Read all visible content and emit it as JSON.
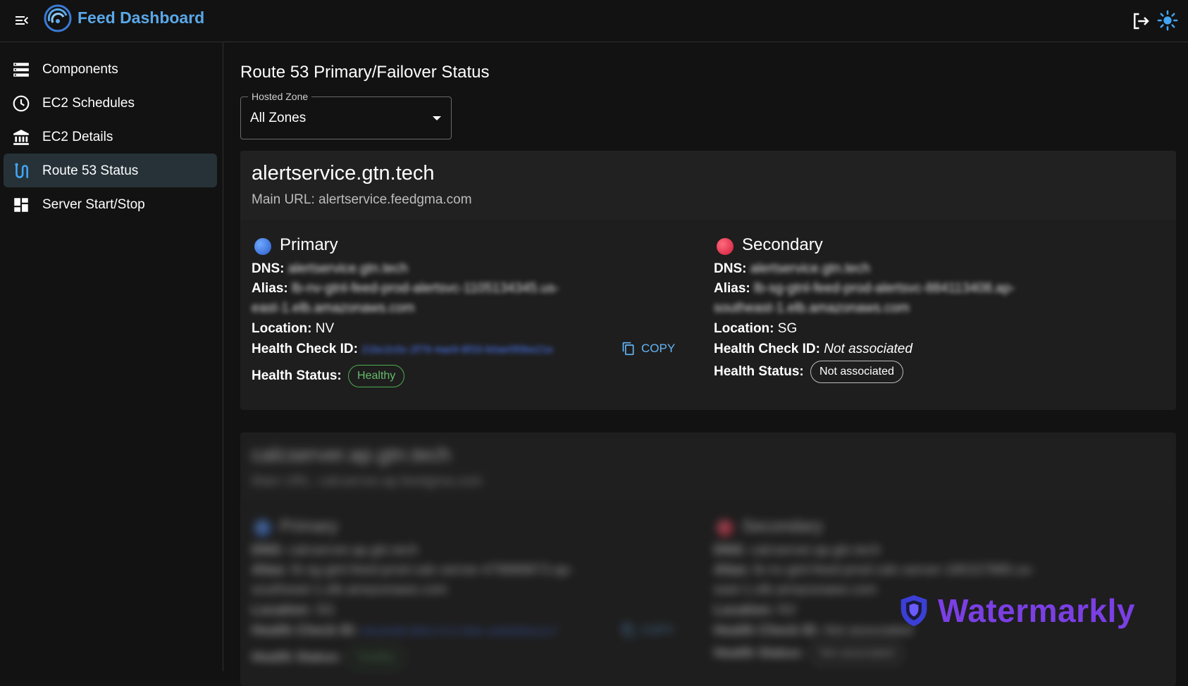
{
  "header": {
    "app_title": "Feed Dashboard",
    "menu_icon": "menu-collapse-icon",
    "logout_icon": "logout-icon",
    "theme_icon": "sun-icon",
    "brand_color": "#5aa8e8"
  },
  "sidebar": {
    "items": [
      {
        "label": "Components",
        "icon": "list-icon",
        "active": false
      },
      {
        "label": "EC2 Schedules",
        "icon": "clock-icon",
        "active": false
      },
      {
        "label": "EC2 Details",
        "icon": "bank-icon",
        "active": false
      },
      {
        "label": "Route 53 Status",
        "icon": "route-icon",
        "active": true
      },
      {
        "label": "Server Start/Stop",
        "icon": "dashboard-icon",
        "active": false
      }
    ]
  },
  "main": {
    "page_title": "Route 53 Primary/Failover Status",
    "hosted_zone": {
      "label": "Hosted Zone",
      "value": "All Zones"
    },
    "records": [
      {
        "name": "alertservice.gtn.tech",
        "main_url_label": "Main URL:",
        "main_url": "alertservice.feedgma.com",
        "primary": {
          "role": "Primary",
          "dns_label": "DNS:",
          "dns": "alertservice.gtn.tech",
          "alias_label": "Alias:",
          "alias_line1": "lb-nv-gtnl-feed-prod-alertsvc-1105134345.us-",
          "alias_line2": "east-1.elb.amazonaws.com",
          "location_label": "Location:",
          "location": "NV",
          "health_check_label": "Health Check ID:",
          "health_check_id": "21bc2c0c-2f79-4ae9-8f33-b0ae5f0be21e",
          "copy_label": "COPY",
          "health_status_label": "Health Status:",
          "health_status": "Healthy"
        },
        "secondary": {
          "role": "Secondary",
          "dns_label": "DNS:",
          "dns": "alertservice.gtn.tech",
          "alias_label": "Alias:",
          "alias_line1": "lb-sg-gtnl-feed-prod-alertsvc-884113408.ap-",
          "alias_line2": "southeast-1.elb.amazonaws.com",
          "location_label": "Location:",
          "location": "SG",
          "health_check_label": "Health Check ID:",
          "health_check_id": "Not associated",
          "health_status_label": "Health Status:",
          "health_status": "Not associated"
        }
      },
      {
        "name": "calcserver.ap.gtn.tech",
        "main_url_label": "Main URL:",
        "main_url": "calcserver.ap.feedgma.com",
        "primary": {
          "role": "Primary",
          "dns_label": "DNS:",
          "dns": "calcserver.ap.gtn.tech",
          "alias_label": "Alias:",
          "alias_line1": "lb-sg-gtnl-feed-prod-calc-server-478888873.ap-",
          "alias_line2": "southeast-1.elb.amazonaws.com",
          "location_label": "Location:",
          "location": "SG",
          "health_check_label": "Health Check ID:",
          "health_check_id": "b8cdc8d0-f86d-4712-9b6c-a06d55ba12c7",
          "copy_label": "COPY",
          "health_status_label": "Health Status:",
          "health_status": "Healthy"
        },
        "secondary": {
          "role": "Secondary",
          "dns_label": "DNS:",
          "dns": "calcserver.ap.gtn.tech",
          "alias_label": "Alias:",
          "alias_line1": "lb-nv-gtnl-feed-prod-calc-server-180157880.us-",
          "alias_line2": "east-1.elb.amazonaws.com",
          "location_label": "Location:",
          "location": "NV",
          "health_check_label": "Health Check ID:",
          "health_check_id": "Not associated",
          "health_status_label": "Health Status:",
          "health_status": "Not associated"
        }
      }
    ]
  },
  "watermark": {
    "text": "Watermarkly",
    "icon": "shield-icon",
    "color": "#7b3fe4"
  }
}
